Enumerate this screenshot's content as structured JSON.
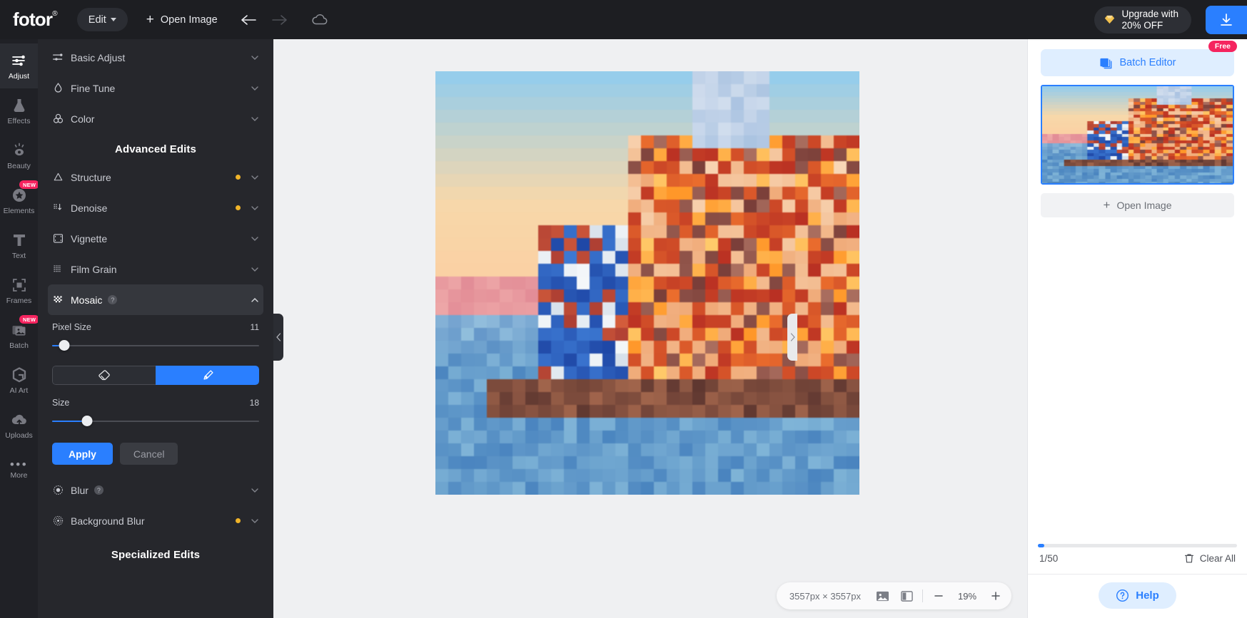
{
  "header": {
    "logo": "fotor",
    "logo_mark": "®",
    "edit_label": "Edit",
    "open_image_label": "Open Image",
    "back_icon": "arrow-left-icon",
    "forward_icon": "arrow-right-icon",
    "cloud_icon": "cloud-icon",
    "upgrade_line1": "Upgrade with",
    "upgrade_line2": "20% OFF",
    "download_icon": "download-icon"
  },
  "rail": {
    "items": [
      {
        "label": "Adjust",
        "icon": "sliders-icon",
        "active": true,
        "badge": ""
      },
      {
        "label": "Effects",
        "icon": "flask-icon",
        "active": false,
        "badge": ""
      },
      {
        "label": "Beauty",
        "icon": "eye-icon",
        "active": false,
        "badge": ""
      },
      {
        "label": "Elements",
        "icon": "star-icon",
        "active": false,
        "badge": "NEW"
      },
      {
        "label": "Text",
        "icon": "text-t-icon",
        "active": false,
        "badge": ""
      },
      {
        "label": "Frames",
        "icon": "frame-icon",
        "active": false,
        "badge": ""
      },
      {
        "label": "Batch",
        "icon": "batch-icon",
        "active": false,
        "badge": "NEW"
      },
      {
        "label": "AI Art",
        "icon": "ai-art-icon",
        "active": false,
        "badge": ""
      },
      {
        "label": "Uploads",
        "icon": "cloud-up-icon",
        "active": false,
        "badge": ""
      },
      {
        "label": "More",
        "icon": "ellipsis-icon",
        "active": false,
        "badge": ""
      }
    ]
  },
  "panel": {
    "top_rows": [
      {
        "label": "Basic Adjust",
        "icon": "sliders-icon",
        "dot": false
      },
      {
        "label": "Fine Tune",
        "icon": "droplet-icon",
        "dot": false
      },
      {
        "label": "Color",
        "icon": "color-circles-icon",
        "dot": false
      }
    ],
    "advanced_title": "Advanced Edits",
    "advanced_rows": [
      {
        "label": "Structure",
        "icon": "triangle-icon",
        "dot": true
      },
      {
        "label": "Denoise",
        "icon": "denoise-icon",
        "dot": true
      },
      {
        "label": "Vignette",
        "icon": "vignette-icon",
        "dot": false
      },
      {
        "label": "Film Grain",
        "icon": "grain-icon",
        "dot": false
      }
    ],
    "mosaic": {
      "label": "Mosaic",
      "icon": "mosaic-icon",
      "help_glyph": "?",
      "expanded": true,
      "pixel_size_label": "Pixel Size",
      "pixel_size_value": "11",
      "pixel_size_pct": 6,
      "eraser_icon": "eraser-icon",
      "brush_icon": "brush-icon",
      "active_tool": "brush",
      "size_label": "Size",
      "size_value": "18",
      "size_pct": 17,
      "apply_label": "Apply",
      "cancel_label": "Cancel"
    },
    "after_rows": [
      {
        "label": "Blur",
        "icon": "blur-icon",
        "dot": false,
        "help": true
      },
      {
        "label": "Background Blur",
        "icon": "bg-blur-icon",
        "dot": true,
        "help": false
      }
    ],
    "specialized_title": "Specialized Edits"
  },
  "canvas": {
    "collapse_left_icon": "chevron-left-icon",
    "collapse_right_icon": "chevron-right-icon",
    "dimensions": "3557px × 3557px",
    "compare_icon": "image-icon",
    "split-view_icon": "split-view-icon",
    "zoom_out_label": "−",
    "zoom_level": "19%",
    "zoom_in_label": "+"
  },
  "right": {
    "free_badge": "Free",
    "batch_editor_label": "Batch Editor",
    "batch_editor_icon": "layers-icon",
    "thumb_selected": true,
    "open_image_label": "Open Image",
    "counter": "1/50",
    "clear_all_label": "Clear All",
    "trash_icon": "trash-icon",
    "help_label": "Help",
    "help_icon": "question-circle-icon"
  },
  "colors": {
    "accent": "#2a7fff",
    "badge_pink": "#f5245f",
    "dot_amber": "#f0b429",
    "panel_bg": "#26272c",
    "rail_bg": "#202126",
    "canvas_bg": "#eff0f2"
  }
}
